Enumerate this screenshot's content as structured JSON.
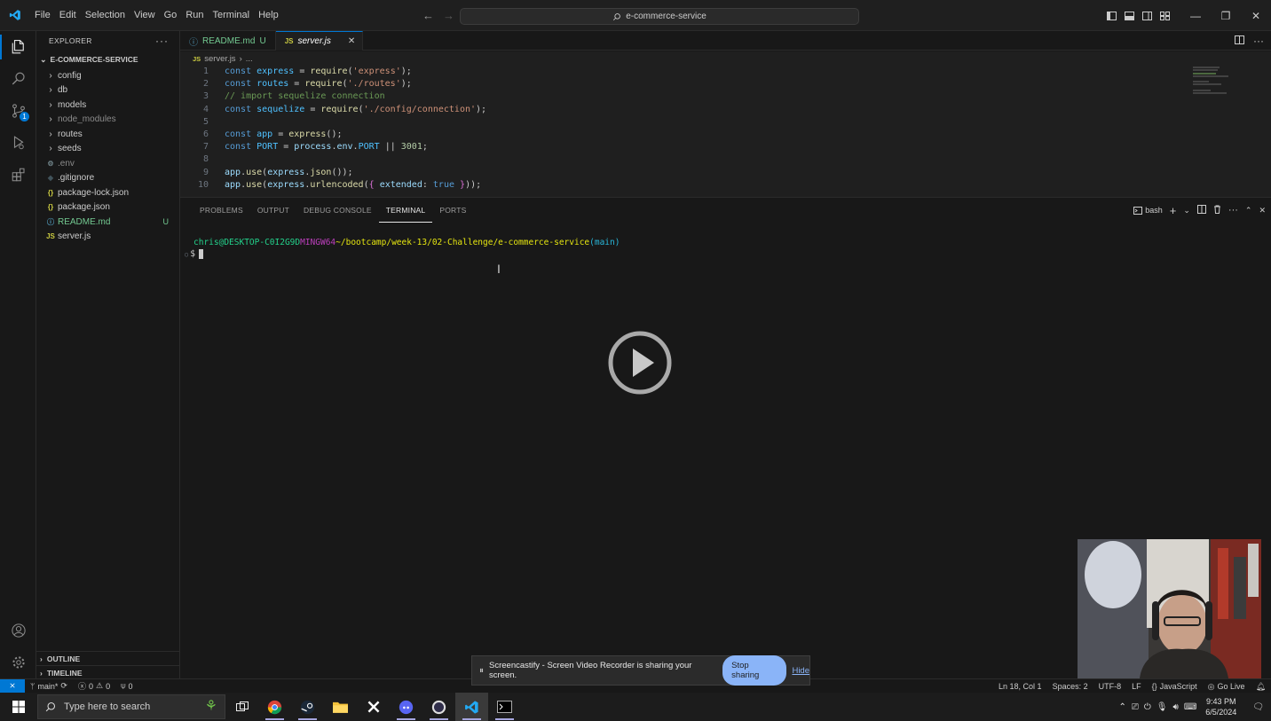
{
  "titlebar": {
    "menu": [
      "File",
      "Edit",
      "Selection",
      "View",
      "Go",
      "Run",
      "Terminal",
      "Help"
    ],
    "search": "e-commerce-service"
  },
  "sidebar": {
    "header": "EXPLORER",
    "folder": "E-COMMERCE-SERVICE",
    "items": [
      {
        "name": "config",
        "type": "folder"
      },
      {
        "name": "db",
        "type": "folder"
      },
      {
        "name": "models",
        "type": "folder"
      },
      {
        "name": "node_modules",
        "type": "folder",
        "dim": true
      },
      {
        "name": "routes",
        "type": "folder"
      },
      {
        "name": "seeds",
        "type": "folder"
      },
      {
        "name": ".env",
        "type": "env",
        "dim": true
      },
      {
        "name": ".gitignore",
        "type": "git"
      },
      {
        "name": "package-lock.json",
        "type": "json"
      },
      {
        "name": "package.json",
        "type": "json"
      },
      {
        "name": "README.md",
        "type": "md",
        "status": "U"
      },
      {
        "name": "server.js",
        "type": "js"
      }
    ],
    "outline": "OUTLINE",
    "timeline": "TIMELINE"
  },
  "tabs": [
    {
      "label": "README.md",
      "status": "U",
      "active": false
    },
    {
      "label": "server.js",
      "active": true
    }
  ],
  "breadcrumb": {
    "file": "server.js",
    "more": "..."
  },
  "editor": {
    "line_numbers": [
      "1",
      "2",
      "3",
      "4",
      "5",
      "6",
      "7",
      "8",
      "9",
      "10"
    ],
    "lines": [
      "const express = require('express');",
      "const routes = require('./routes');",
      "// import sequelize connection",
      "const sequelize = require('./config/connection');",
      "",
      "const app = express();",
      "const PORT = process.env.PORT || 3001;",
      "",
      "app.use(express.json());",
      "app.use(express.urlencoded({ extended: true }));"
    ]
  },
  "panel": {
    "tabs": [
      "PROBLEMS",
      "OUTPUT",
      "DEBUG CONSOLE",
      "TERMINAL",
      "PORTS"
    ],
    "active_tab": "TERMINAL",
    "shell": "bash",
    "prompt": {
      "user": "chris@DESKTOP-C0I2G9D",
      "system": "MINGW64",
      "path": "~/bootcamp/week-13/02-Challenge/e-commerce-service",
      "branch": "(main)",
      "symbol": "$"
    }
  },
  "statusbar": {
    "branch": "main*",
    "errors": "0",
    "warnings": "0",
    "ports": "0",
    "position": "Ln 18, Col 1",
    "spaces": "Spaces: 2",
    "encoding": "UTF-8",
    "eol": "LF",
    "language": "JavaScript",
    "golive": "Go Live"
  },
  "sharebar": {
    "message": "Screencastify - Screen Video Recorder is sharing your screen.",
    "stop": "Stop sharing",
    "hide": "Hide"
  },
  "taskbar": {
    "search_placeholder": "Type here to search",
    "time": "9:43 PM",
    "date": "6/5/2024"
  },
  "colors": {
    "accent": "#0078d4",
    "background": "#181818",
    "editor_bg": "#1f1f1f"
  }
}
